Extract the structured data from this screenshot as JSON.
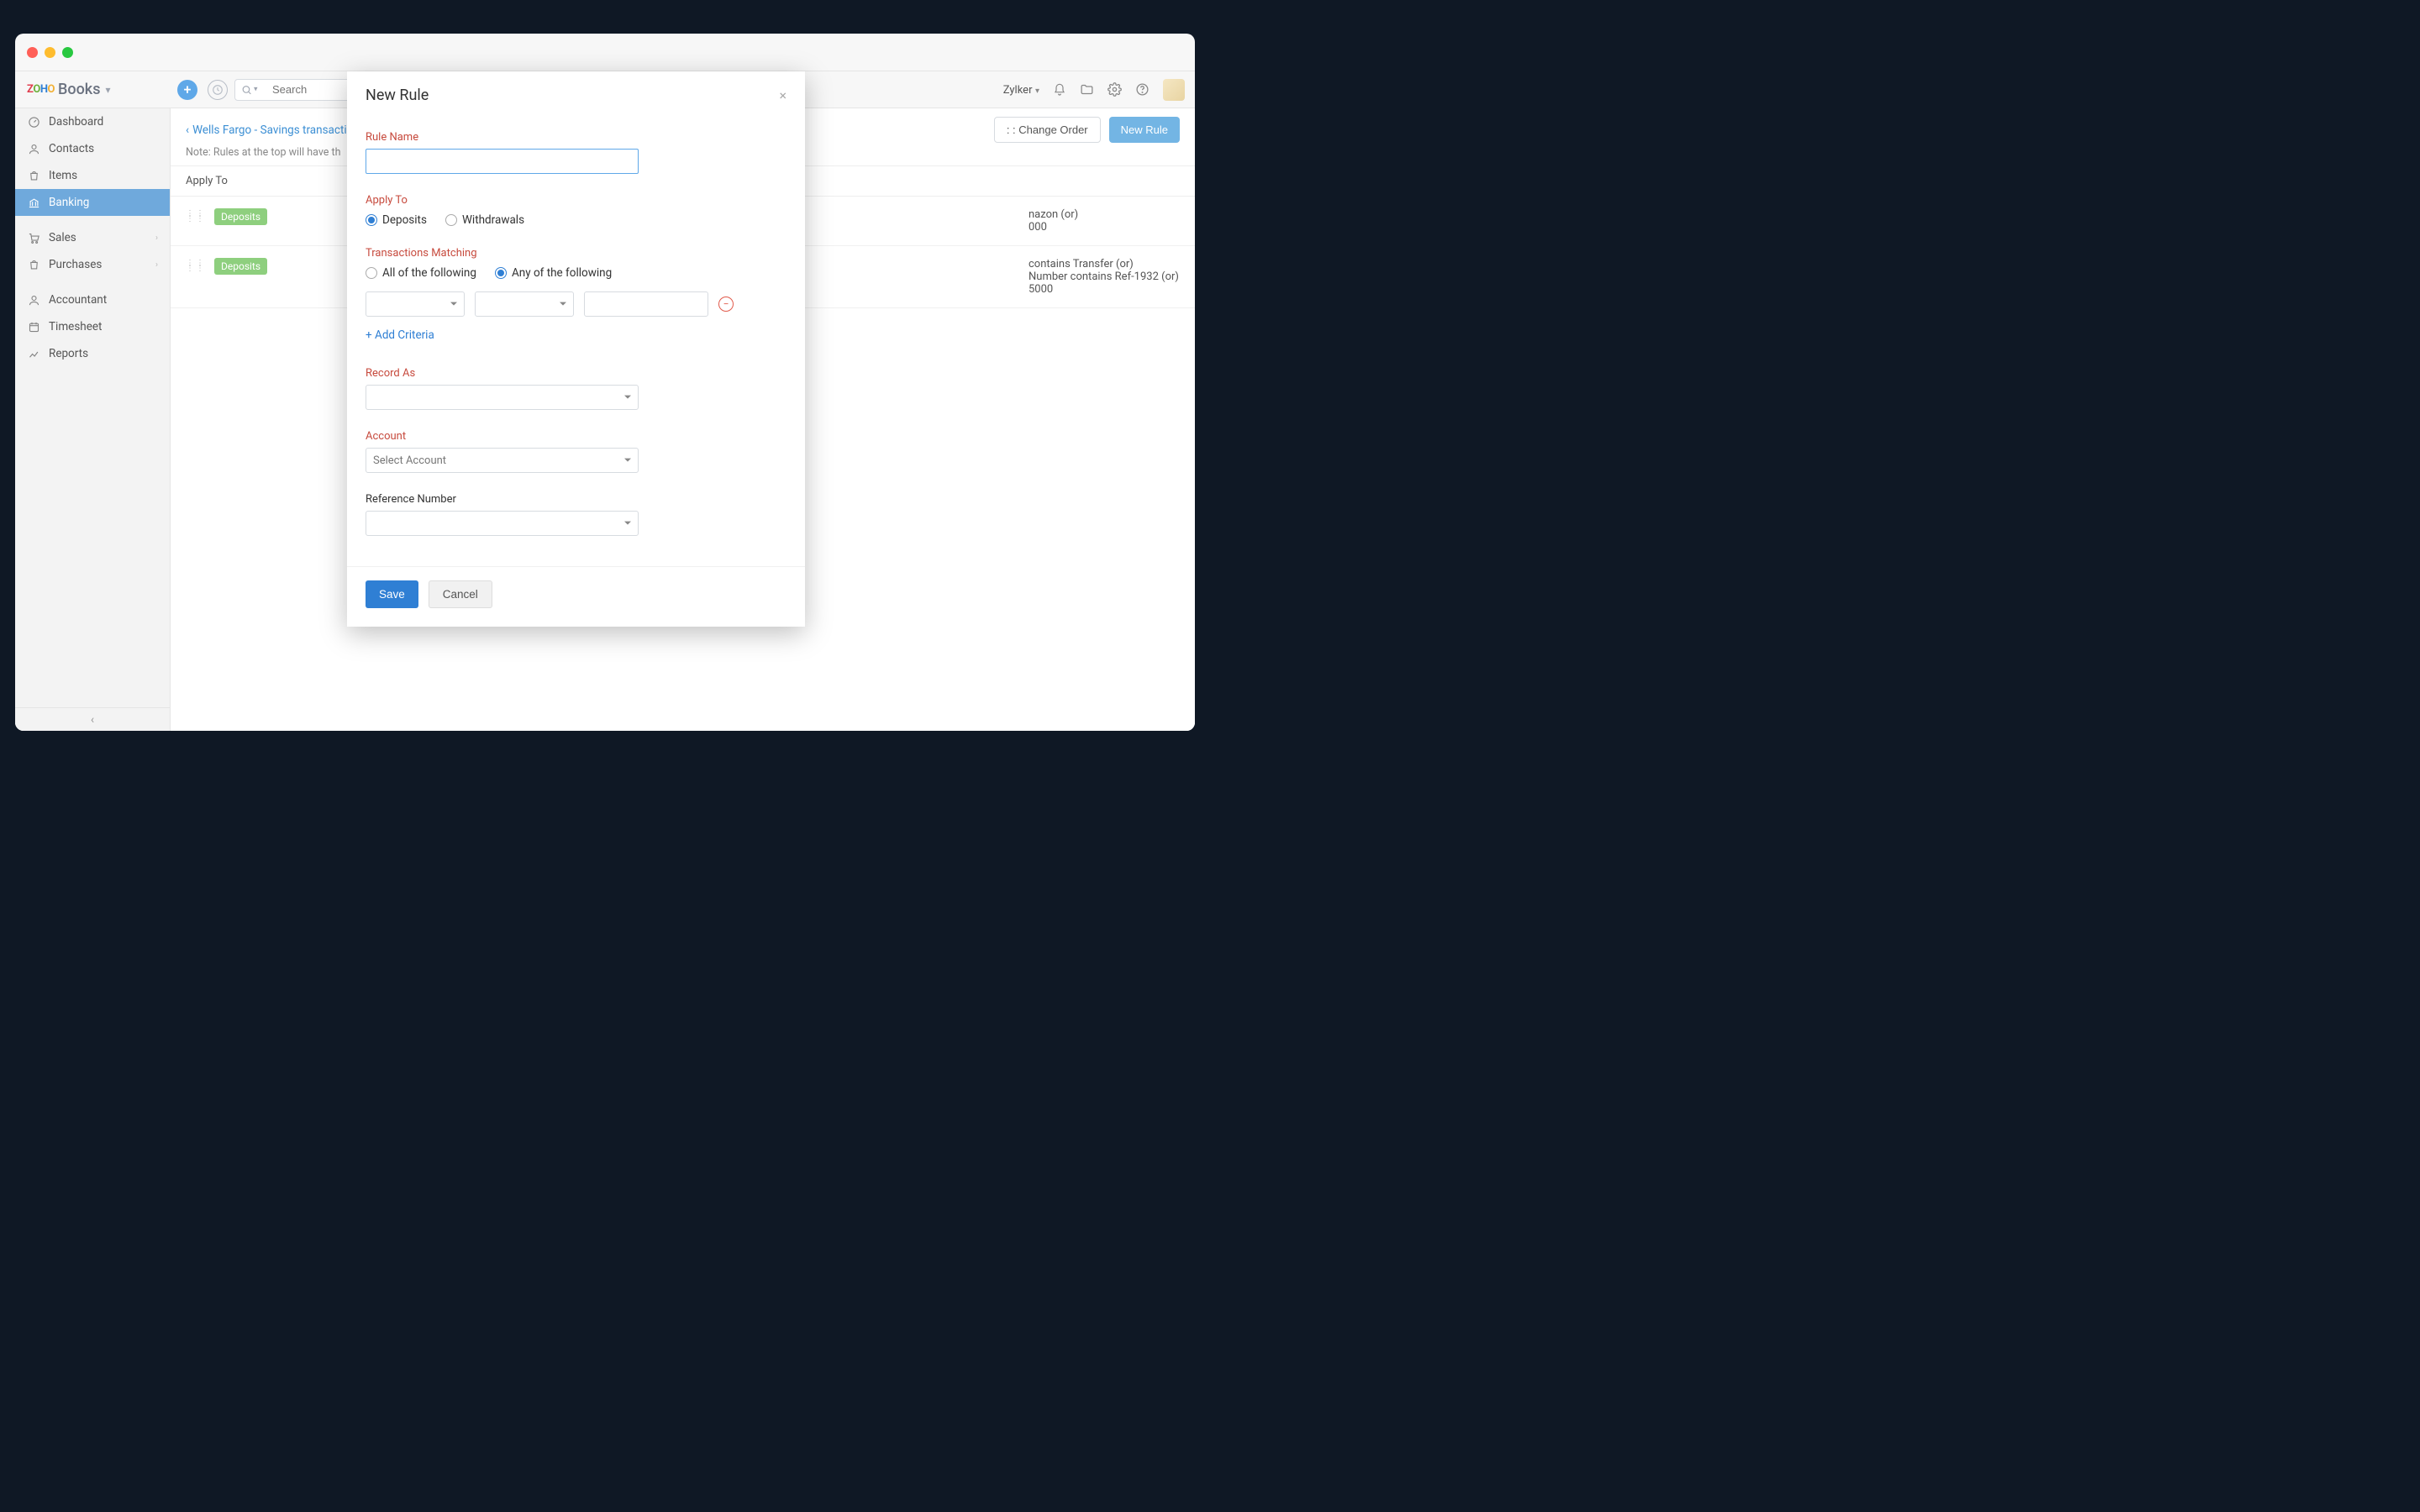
{
  "brand": {
    "product": "Books"
  },
  "search": {
    "placeholder": "Search"
  },
  "org": {
    "name": "Zylker"
  },
  "sidebar": {
    "items": [
      {
        "label": "Dashboard"
      },
      {
        "label": "Contacts"
      },
      {
        "label": "Items"
      },
      {
        "label": "Banking"
      },
      {
        "label": "Sales"
      },
      {
        "label": "Purchases"
      },
      {
        "label": "Accountant"
      },
      {
        "label": "Timesheet"
      },
      {
        "label": "Reports"
      }
    ]
  },
  "breadcrumb": {
    "label": "Wells Fargo - Savings transactio"
  },
  "note": "Note: Rules at the top will have th",
  "main_actions": {
    "change_order": ": : Change Order",
    "new_rule": "New Rule"
  },
  "list_header": "Apply To",
  "rules": [
    {
      "badge": "Deposits",
      "lines": [
        "nazon  (or)",
        "000"
      ]
    },
    {
      "badge": "Deposits",
      "lines": [
        "contains Transfer   (or)",
        "Number contains Ref-1932   (or)",
        "5000"
      ]
    }
  ],
  "modal": {
    "title": "New Rule",
    "labels": {
      "rule_name": "Rule Name",
      "apply_to": "Apply To",
      "tx_matching": "Transactions Matching",
      "record_as": "Record As",
      "account": "Account",
      "refnum": "Reference Number"
    },
    "apply_to": {
      "deposits": "Deposits",
      "withdrawals": "Withdrawals"
    },
    "matching": {
      "all": "All of the following",
      "any": "Any of the following"
    },
    "add_criteria": "+ Add Criteria",
    "account_placeholder": "Select Account",
    "save": "Save",
    "cancel": "Cancel"
  }
}
